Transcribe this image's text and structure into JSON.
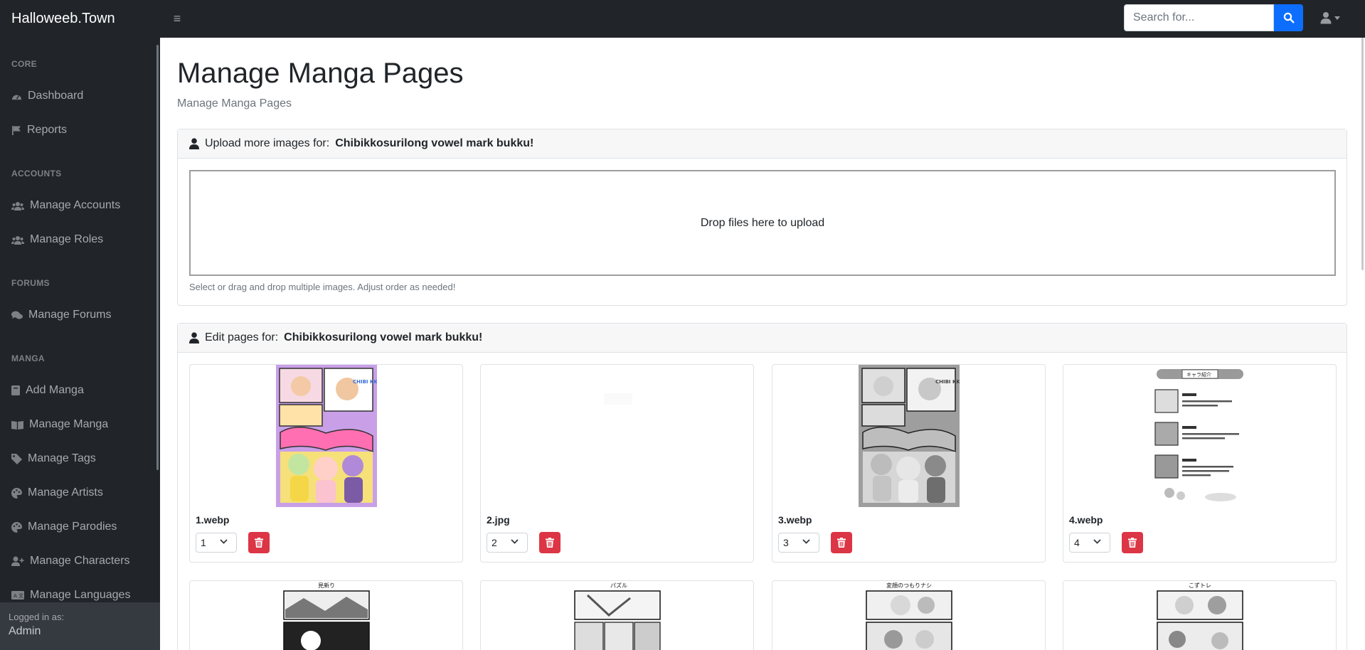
{
  "brand": "Halloweeb.Town",
  "search": {
    "placeholder": "Search for..."
  },
  "sidebar": {
    "sections": [
      {
        "heading": "CORE",
        "items": [
          {
            "label": "Dashboard",
            "icon": "tachometer-icon"
          },
          {
            "label": "Reports",
            "icon": "flag-icon"
          }
        ]
      },
      {
        "heading": "ACCOUNTS",
        "items": [
          {
            "label": "Manage Accounts",
            "icon": "users-icon"
          },
          {
            "label": "Manage Roles",
            "icon": "users-icon"
          }
        ]
      },
      {
        "heading": "FORUMS",
        "items": [
          {
            "label": "Manage Forums",
            "icon": "comments-icon"
          }
        ]
      },
      {
        "heading": "MANGA",
        "items": [
          {
            "label": "Add Manga",
            "icon": "book-icon"
          },
          {
            "label": "Manage Manga",
            "icon": "book-open-icon"
          },
          {
            "label": "Manage Tags",
            "icon": "tag-icon"
          },
          {
            "label": "Manage Artists",
            "icon": "palette-icon"
          },
          {
            "label": "Manage Parodies",
            "icon": "palette-icon"
          },
          {
            "label": "Manage Characters",
            "icon": "user-plus-icon"
          },
          {
            "label": "Manage Languages",
            "icon": "language-icon"
          }
        ]
      }
    ],
    "footer": {
      "logged_in_label": "Logged in as:",
      "username": "Admin"
    }
  },
  "page": {
    "title": "Manage Manga Pages",
    "subtitle": "Manage Manga Pages"
  },
  "upload": {
    "header_prefix": "Upload more images for:",
    "manga_title": "Chibikkosurilong vowel mark bukku!",
    "dropzone_text": "Drop files here to upload",
    "help_text": "Select or drag and drop multiple images. Adjust order as needed!"
  },
  "edit": {
    "header_prefix": "Edit pages for:",
    "manga_title": "Chibikkosurilong vowel mark bukku!",
    "pages": [
      {
        "filename": "1.webp",
        "order": "1"
      },
      {
        "filename": "2.jpg",
        "order": "2"
      },
      {
        "filename": "3.webp",
        "order": "3"
      },
      {
        "filename": "4.webp",
        "order": "4"
      }
    ],
    "next_row_captions": [
      "見新り",
      "パズル",
      "変顔のつもりナシ",
      "こずトレ"
    ],
    "thumb_texts": {
      "cover_badge": "CHIBI KKO",
      "profile_header": "キャラ紹介"
    }
  },
  "colors": {
    "navbar": "#212529",
    "primary": "#0d6efd",
    "danger": "#dc3545",
    "cover_border": "#c9a0e8"
  }
}
